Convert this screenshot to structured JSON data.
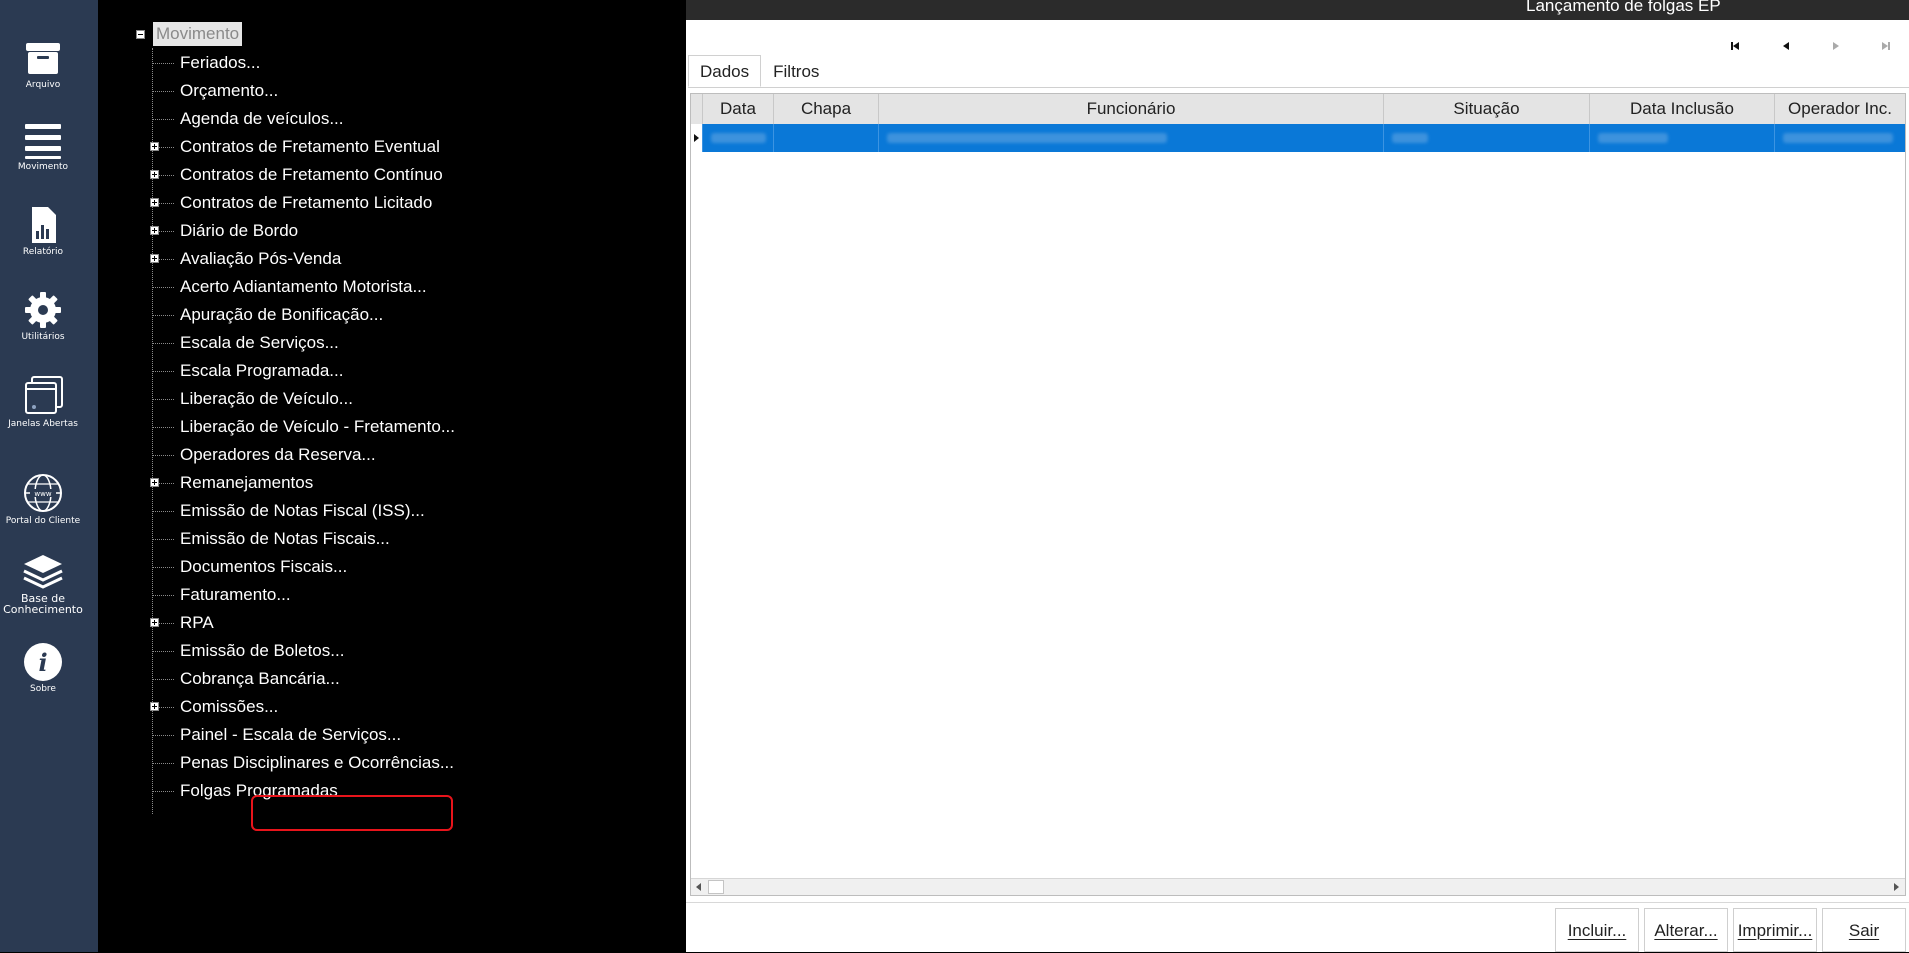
{
  "sidebar": {
    "items": [
      {
        "label": "Arquivo",
        "icon": "archive-icon"
      },
      {
        "label": "Movimento",
        "icon": "hamburger-menu-icon"
      },
      {
        "label": "Relatório",
        "icon": "report-chart-icon"
      },
      {
        "label": "Utilitários",
        "icon": "gear-icon"
      },
      {
        "label": "Janelas Abertas",
        "icon": "windows-stack-icon"
      },
      {
        "label": "Portal do Cliente",
        "icon": "www-globe-icon"
      },
      {
        "label": "Base de\nConhecimento",
        "icon": "layers-icon"
      },
      {
        "label": "Sobre",
        "icon": "info-icon"
      }
    ]
  },
  "tree": {
    "root": "Movimento",
    "items": [
      {
        "label": "Feriados...",
        "expandable": false
      },
      {
        "label": "Orçamento...",
        "expandable": false
      },
      {
        "label": "Agenda de veículos...",
        "expandable": false
      },
      {
        "label": "Contratos de Fretamento Eventual",
        "expandable": true
      },
      {
        "label": "Contratos de Fretamento Contínuo",
        "expandable": true
      },
      {
        "label": "Contratos de Fretamento Licitado",
        "expandable": true
      },
      {
        "label": "Diário de Bordo",
        "expandable": true
      },
      {
        "label": "Avaliação Pós-Venda",
        "expandable": true
      },
      {
        "label": "Acerto Adiantamento Motorista...",
        "expandable": false
      },
      {
        "label": "Apuração de Bonificação...",
        "expandable": false
      },
      {
        "label": "Escala de Serviços...",
        "expandable": false
      },
      {
        "label": "Escala Programada...",
        "expandable": false
      },
      {
        "label": "Liberação de Veículo...",
        "expandable": false
      },
      {
        "label": "Liberação de Veículo - Fretamento...",
        "expandable": false
      },
      {
        "label": "Operadores da Reserva...",
        "expandable": false
      },
      {
        "label": "Remanejamentos",
        "expandable": true
      },
      {
        "label": "Emissão de Notas Fiscal (ISS)...",
        "expandable": false
      },
      {
        "label": "Emissão de Notas Fiscais...",
        "expandable": false
      },
      {
        "label": "Documentos Fiscais...",
        "expandable": false
      },
      {
        "label": "Faturamento...",
        "expandable": false
      },
      {
        "label": "RPA",
        "expandable": true
      },
      {
        "label": "Emissão de Boletos...",
        "expandable": false
      },
      {
        "label": "Cobrança Bancária...",
        "expandable": false
      },
      {
        "label": "Comissões...",
        "expandable": true
      },
      {
        "label": "Painel - Escala de Serviços...",
        "expandable": false
      },
      {
        "label": "Penas Disciplinares e Ocorrências...",
        "expandable": false
      },
      {
        "label": "Folgas Programadas",
        "expandable": false
      }
    ]
  },
  "window": {
    "title": "Lançamento de folgas EP"
  },
  "tabs": [
    "Dados",
    "Filtros"
  ],
  "grid": {
    "columns": [
      "Data",
      "Chapa",
      "Funcionário",
      "Situação",
      "Data Inclusão",
      "Operador Inc."
    ]
  },
  "buttons": {
    "incluir": "Incluir...",
    "alterar": "Alterar...",
    "imprimir": "Imprimir...",
    "sair": "Sair"
  },
  "colors": {
    "sidebar_bg": "#2b3a52",
    "selected_row": "#0a78d7",
    "highlight_box": "#e8141b"
  }
}
